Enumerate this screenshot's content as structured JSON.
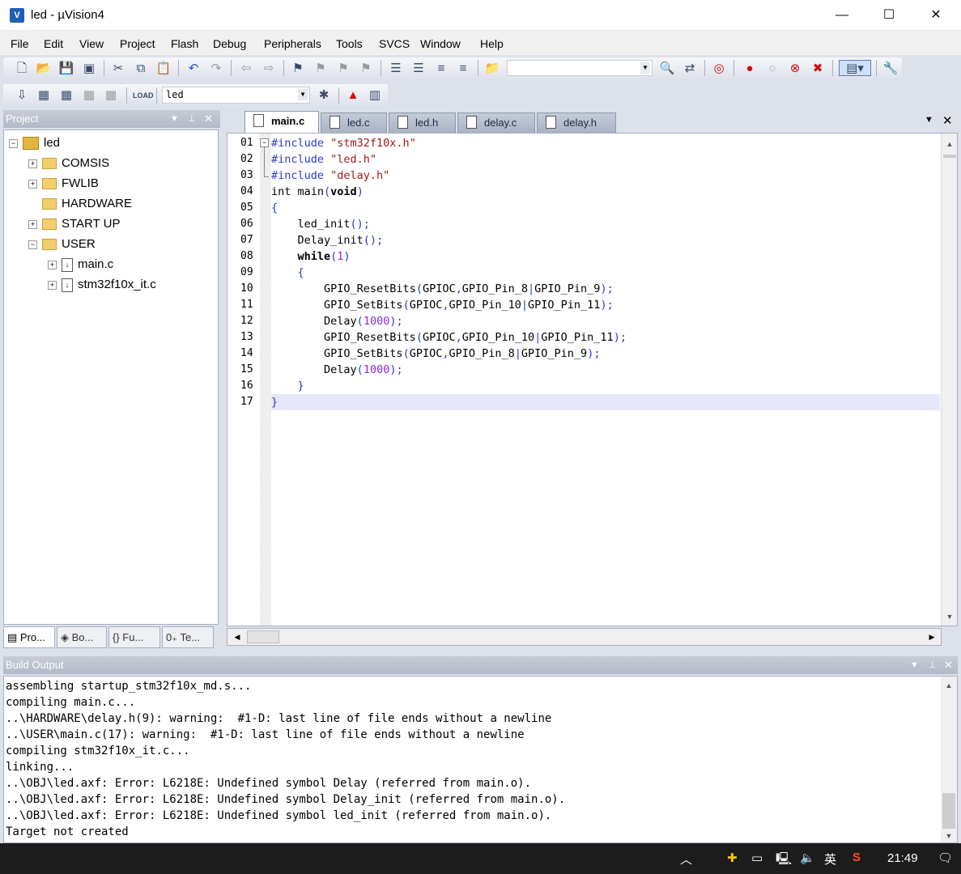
{
  "window": {
    "title": "led  - µVision4",
    "app_icon": "uv-icon",
    "minimize": "—",
    "maximize": "☐",
    "close": "✕"
  },
  "menu": [
    "File",
    "Edit",
    "View",
    "Project",
    "Flash",
    "Debug",
    "Peripherals",
    "Tools",
    "SVCS",
    "Window",
    "Help"
  ],
  "toolbar": {
    "find_value": "",
    "target_value": "led"
  },
  "project_pane": {
    "title": "Project",
    "tree": {
      "root": "led",
      "groups": [
        {
          "label": "COMSIS"
        },
        {
          "label": "FWLIB"
        },
        {
          "label": "HARDWARE"
        },
        {
          "label": "START UP"
        },
        {
          "label": "USER"
        }
      ],
      "files": [
        {
          "label": "main.c"
        },
        {
          "label": "stm32f10x_it.c"
        }
      ]
    },
    "tabs": [
      {
        "label": "Pro..."
      },
      {
        "label": "Bo..."
      },
      {
        "label": "{} Fu..."
      },
      {
        "label": "0₊ Te..."
      }
    ]
  },
  "editor": {
    "tabs": [
      {
        "label": "main.c",
        "active": true
      },
      {
        "label": "led.c",
        "active": false
      },
      {
        "label": "led.h",
        "active": false
      },
      {
        "label": "delay.c",
        "active": false
      },
      {
        "label": "delay.h",
        "active": false
      }
    ],
    "line_numbers": [
      "01",
      "02",
      "03",
      "04",
      "05",
      "06",
      "07",
      "08",
      "09",
      "10",
      "11",
      "12",
      "13",
      "14",
      "15",
      "16",
      "17"
    ],
    "current_line": 17,
    "code": [
      [
        {
          "t": "#include ",
          "c": "kw-pre"
        },
        {
          "t": "\"stm32f10x.h\"",
          "c": "str"
        }
      ],
      [
        {
          "t": "#include ",
          "c": "kw-pre"
        },
        {
          "t": "\"led.h\"",
          "c": "str"
        }
      ],
      [
        {
          "t": "#include ",
          "c": "kw-pre"
        },
        {
          "t": "\"delay.h\"",
          "c": "str"
        }
      ],
      [
        {
          "t": "int main",
          "c": ""
        },
        {
          "t": "(",
          "c": "punc"
        },
        {
          "t": "void",
          "c": "kw"
        },
        {
          "t": ")",
          "c": "punc"
        }
      ],
      [
        {
          "t": "{",
          "c": "punc"
        }
      ],
      [
        {
          "t": "    led_init",
          "c": ""
        },
        {
          "t": "();",
          "c": "punc"
        }
      ],
      [
        {
          "t": "    Delay_init",
          "c": ""
        },
        {
          "t": "();",
          "c": "punc"
        }
      ],
      [
        {
          "t": "    while",
          "c": "kw"
        },
        {
          "t": "(",
          "c": "punc"
        },
        {
          "t": "1",
          "c": "num"
        },
        {
          "t": ")",
          "c": "punc"
        }
      ],
      [
        {
          "t": "    {",
          "c": "punc"
        }
      ],
      [
        {
          "t": "        GPIO_ResetBits",
          "c": ""
        },
        {
          "t": "(",
          "c": "punc"
        },
        {
          "t": "GPIOC",
          "c": ""
        },
        {
          "t": ",",
          "c": "punc"
        },
        {
          "t": "GPIO_Pin_8",
          "c": ""
        },
        {
          "t": "|",
          "c": "punc"
        },
        {
          "t": "GPIO_Pin_9",
          "c": ""
        },
        {
          "t": ");",
          "c": "punc"
        }
      ],
      [
        {
          "t": "        GPIO_SetBits",
          "c": ""
        },
        {
          "t": "(",
          "c": "punc"
        },
        {
          "t": "GPIOC",
          "c": ""
        },
        {
          "t": ",",
          "c": "punc"
        },
        {
          "t": "GPIO_Pin_10",
          "c": ""
        },
        {
          "t": "|",
          "c": "punc"
        },
        {
          "t": "GPIO_Pin_11",
          "c": ""
        },
        {
          "t": ");",
          "c": "punc"
        }
      ],
      [
        {
          "t": "        Delay",
          "c": ""
        },
        {
          "t": "(",
          "c": "punc"
        },
        {
          "t": "1000",
          "c": "num"
        },
        {
          "t": ");",
          "c": "punc"
        }
      ],
      [
        {
          "t": "        GPIO_ResetBits",
          "c": ""
        },
        {
          "t": "(",
          "c": "punc"
        },
        {
          "t": "GPIOC",
          "c": ""
        },
        {
          "t": ",",
          "c": "punc"
        },
        {
          "t": "GPIO_Pin_10",
          "c": ""
        },
        {
          "t": "|",
          "c": "punc"
        },
        {
          "t": "GPIO_Pin_11",
          "c": ""
        },
        {
          "t": ");",
          "c": "punc"
        }
      ],
      [
        {
          "t": "        GPIO_SetBits",
          "c": ""
        },
        {
          "t": "(",
          "c": "punc"
        },
        {
          "t": "GPIOC",
          "c": ""
        },
        {
          "t": ",",
          "c": "punc"
        },
        {
          "t": "GPIO_Pin_8",
          "c": ""
        },
        {
          "t": "|",
          "c": "punc"
        },
        {
          "t": "GPIO_Pin_9",
          "c": ""
        },
        {
          "t": ");",
          "c": "punc"
        }
      ],
      [
        {
          "t": "        Delay",
          "c": ""
        },
        {
          "t": "(",
          "c": "punc"
        },
        {
          "t": "1000",
          "c": "num"
        },
        {
          "t": ");",
          "c": "punc"
        }
      ],
      [
        {
          "t": "    }",
          "c": "punc"
        }
      ],
      [
        {
          "t": "}",
          "c": "punc"
        }
      ]
    ]
  },
  "build_output": {
    "title": "Build Output",
    "lines": [
      "assembling startup_stm32f10x_md.s...",
      "compiling main.c...",
      "..\\HARDWARE\\delay.h(9): warning:  #1-D: last line of file ends without a newline",
      "..\\USER\\main.c(17): warning:  #1-D: last line of file ends without a newline",
      "compiling stm32f10x_it.c...",
      "linking...",
      "..\\OBJ\\led.axf: Error: L6218E: Undefined symbol Delay (referred from main.o).",
      "..\\OBJ\\led.axf: Error: L6218E: Undefined symbol Delay_init (referred from main.o).",
      "..\\OBJ\\led.axf: Error: L6218E: Undefined symbol led_init (referred from main.o).",
      "Target not created"
    ]
  },
  "taskbar": {
    "ime": "英",
    "time": "21:49"
  },
  "colors": {
    "accent_blue": "#2a3ad4",
    "string_red": "#a01818",
    "number_purple": "#8a2be2",
    "current_line": "#e6e8fa",
    "taskbar": "#1c1c1c"
  }
}
